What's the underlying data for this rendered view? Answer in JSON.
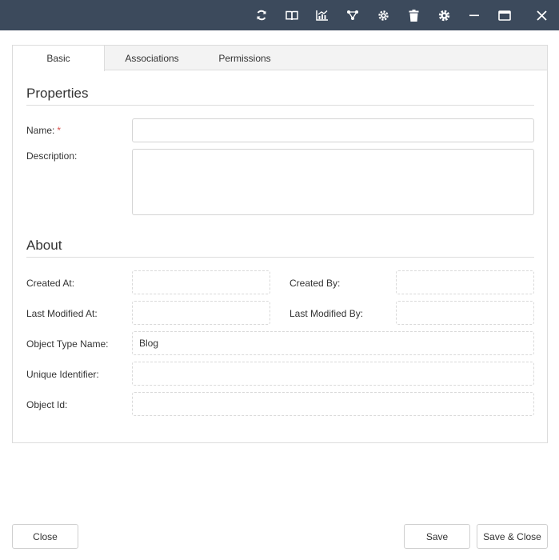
{
  "toolbar": {
    "icons": [
      "refresh-icon",
      "book-icon",
      "chart-icon",
      "graph-icon",
      "settings-alt-icon",
      "trash-icon",
      "gear-icon",
      "minimize-icon",
      "maximize-icon",
      "close-icon"
    ]
  },
  "tabs": [
    {
      "label": "Basic",
      "active": true
    },
    {
      "label": "Associations",
      "active": false
    },
    {
      "label": "Permissions",
      "active": false
    }
  ],
  "properties": {
    "title": "Properties",
    "name_label": "Name:",
    "required_mark": "*",
    "name_value": "",
    "description_label": "Description:",
    "description_value": ""
  },
  "about": {
    "title": "About",
    "created_at_label": "Created At:",
    "created_at_value": "",
    "created_by_label": "Created By:",
    "created_by_value": "",
    "last_modified_at_label": "Last Modified At:",
    "last_modified_at_value": "",
    "last_modified_by_label": "Last Modified By:",
    "last_modified_by_value": "",
    "object_type_name_label": "Object Type Name:",
    "object_type_name_value": "Blog",
    "unique_identifier_label": "Unique Identifier:",
    "unique_identifier_value": "",
    "object_id_label": "Object Id:",
    "object_id_value": ""
  },
  "footer": {
    "close_label": "Close",
    "save_label": "Save",
    "save_close_label": "Save & Close"
  },
  "colors": {
    "titlebar": "#3c4a5c",
    "required": "#d9534f"
  }
}
